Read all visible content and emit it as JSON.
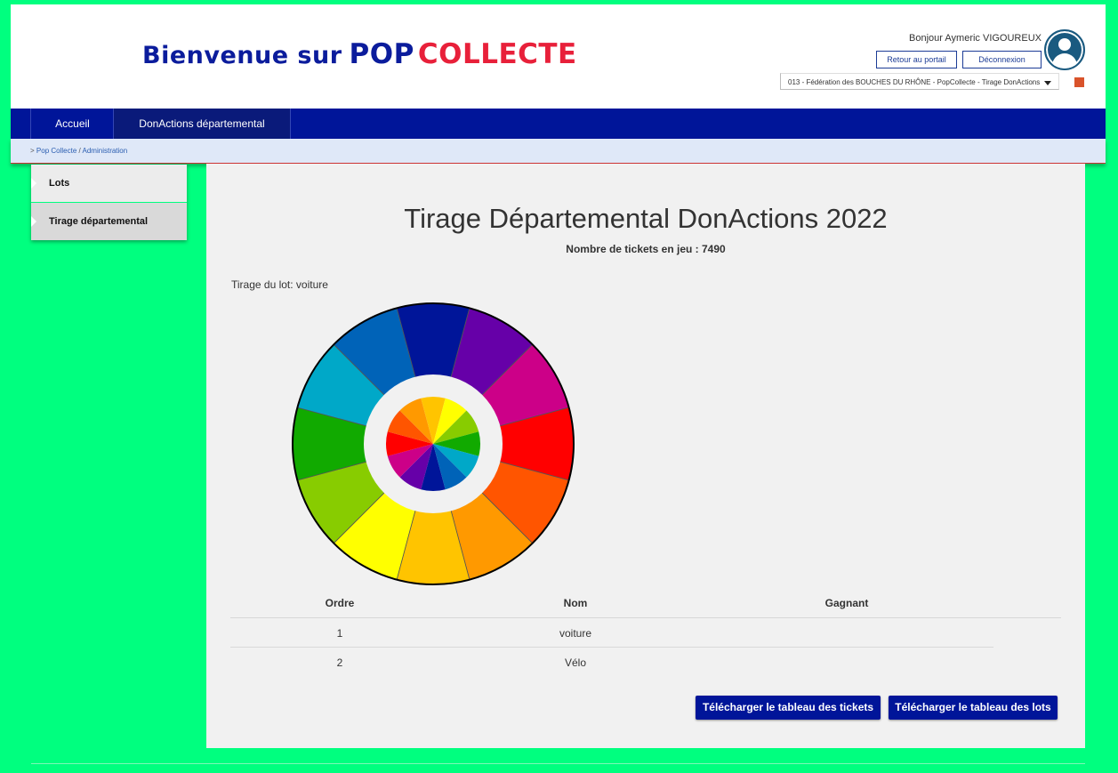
{
  "header": {
    "brand_prefix": "Bienvenue sur",
    "brand_pop": "POP",
    "brand_collecte": "COLLECTE",
    "greeting": "Bonjour Aymeric VIGOUREUX",
    "portal_button": "Retour au portail",
    "logout_button": "Déconnexion",
    "context_select": "013 - Fédération des BOUCHES DU RHÔNE - PopCollecte - Tirage DonActions"
  },
  "nav": {
    "items": [
      {
        "label": "Accueil"
      },
      {
        "label": "DonActions départemental"
      }
    ]
  },
  "breadcrumb": {
    "prefix": ">",
    "part1": "Pop Collecte",
    "separator": "/",
    "part2": "Administration"
  },
  "sidebar": {
    "items": [
      {
        "label": "Lots"
      },
      {
        "label": "Tirage départemental"
      }
    ]
  },
  "main": {
    "title": "Tirage Départemental DonActions 2022",
    "tickets_label": "Nombre de tickets en jeu : 7490",
    "lot_label": "Tirage du lot: voiture",
    "wheel_colors": [
      "#001599",
      "#6600a8",
      "#cc0088",
      "#ff0000",
      "#ff5500",
      "#ff9900",
      "#ffc400",
      "#ffff00",
      "#88cc00",
      "#11aa00",
      "#00a8c8",
      "#0063b8"
    ],
    "table": {
      "headers": [
        "Ordre",
        "Nom",
        "Gagnant"
      ],
      "rows": [
        {
          "ordre": "1",
          "nom": "voiture",
          "gagnant": ""
        },
        {
          "ordre": "2",
          "nom": "Vélo",
          "gagnant": ""
        }
      ]
    },
    "download_tickets": "Télécharger le tableau des tickets",
    "download_lots": "Télécharger le tableau des lots"
  },
  "colors": {
    "page_background": "#00ff7f",
    "nav_background": "#001599",
    "brand_blue": "#0b1c9c",
    "brand_red": "#e8203a",
    "accent_orange": "#d9532b"
  }
}
